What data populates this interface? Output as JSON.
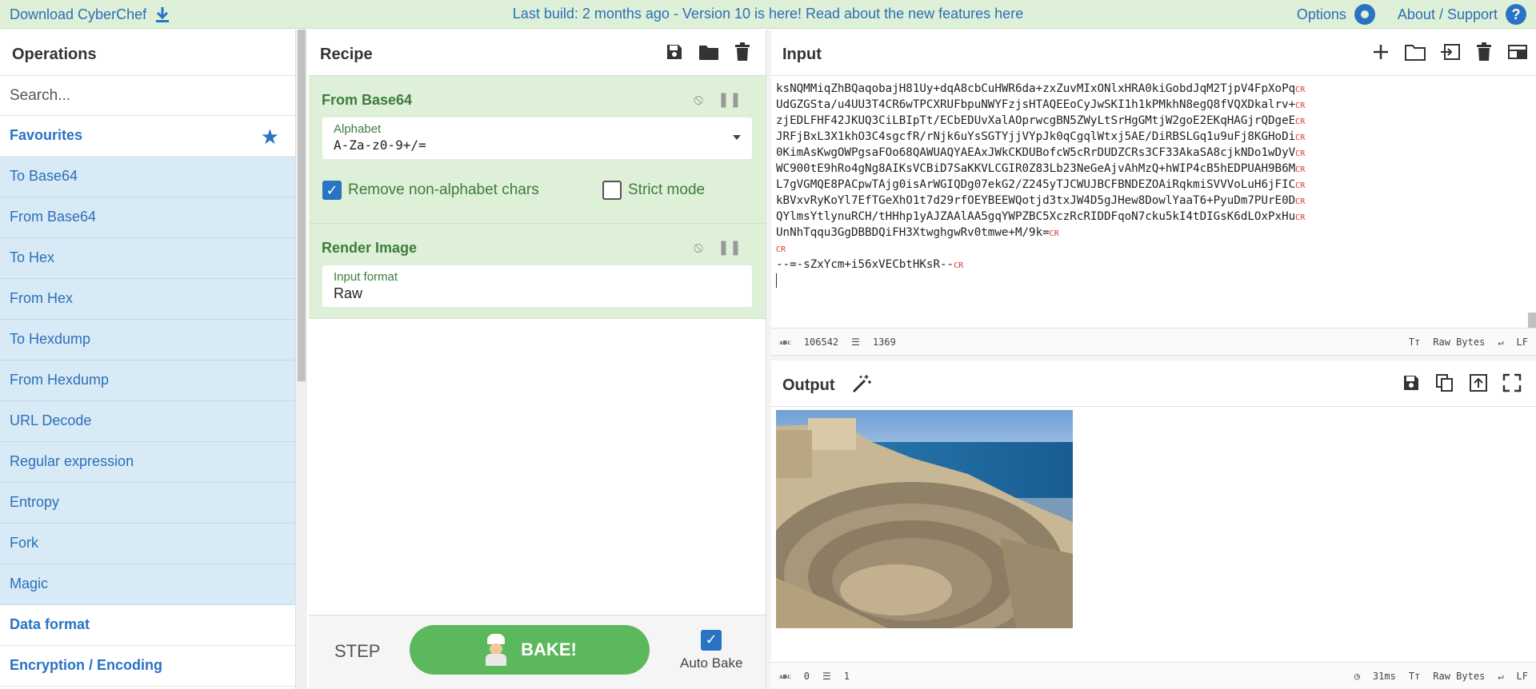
{
  "banner": {
    "download_label": "Download CyberChef",
    "notice": "Last build: 2 months ago - Version 10 is here! Read about the new features here",
    "options_label": "Options",
    "about_label": "About / Support",
    "help_glyph": "?"
  },
  "operations": {
    "title": "Operations",
    "search_placeholder": "Search...",
    "favourites_label": "Favourites",
    "items": [
      "To Base64",
      "From Base64",
      "To Hex",
      "From Hex",
      "To Hexdump",
      "From Hexdump",
      "URL Decode",
      "Regular expression",
      "Entropy",
      "Fork",
      "Magic"
    ],
    "categories_after": [
      "Data format",
      "Encryption / Encoding"
    ]
  },
  "recipe": {
    "title": "Recipe",
    "ops": [
      {
        "name": "From Base64",
        "alphabet_label": "Alphabet",
        "alphabet_value": "A-Za-z0-9+/=",
        "remove_label": "Remove non-alphabet chars",
        "remove_checked": true,
        "strict_label": "Strict mode",
        "strict_checked": false
      },
      {
        "name": "Render Image",
        "format_label": "Input format",
        "format_value": "Raw"
      }
    ],
    "step_label": "STEP",
    "bake_label": "BAKE!",
    "autobake_label": "Auto Bake",
    "autobake_checked": true
  },
  "input": {
    "title": "Input",
    "lines": [
      "ksNQMMiqZhBQaqobajH81Uy+dqA8cbCuHWR6da+zxZuvMIxONlxHRA0kiGobdJqM2TjpV4FpXoPq",
      "UdGZGSta/u4UU3T4CR6wTPCXRUFbpuNWYFzjsHTAQEEoCyJwSKI1h1kPMkhN8egQ8fVQXDkalrv+",
      "zjEDLFHF42JKUQ3CiLBIpTt/ECbEDUvXalAOprwcgBN5ZWyLtSrHgGMtjW2goE2EKqHAGjrQDgeE",
      "JRFjBxL3X1khO3C4sgcfR/rNjk6uYsSGTYjjVYpJk0qCgqlWtxj5AE/DiRBSLGq1u9uFj8KGHoDi",
      "0KimAsKwgOWPgsaFOo68QAWUAQYAEAxJWkCKDUBofcW5cRrDUDZCRs3CF33AkaSA8cjkNDo1wDyV",
      "WC900tE9hRo4gNg8AIKsVCBiD7SaKKVLCGIR0Z83Lb23NeGeAjvAhMzQ+hWIP4cB5hEDPUAH9B6M",
      "L7gVGMQE8PACpwTAjg0isArWGIQDg07ekG2/Z245yTJCWUJBCFBNDEZOAiRqkmiSVVVoLuH6jFIC",
      "kBVxvRyKoYl7EfTGeXhO1t7d29rfOEYBEEWQotjd3txJW4D5gJHew8DowlYaaT6+PyuDm7PUrE0D",
      "QYlmsYtlynuRCH/tHHhp1yAJZAAlAA5gqYWPZBC5XczRcRIDDFqoN7cku5kI4tDIGsK6dLOxPxHu",
      "UnNhTqqu3GgDBBDQiFH3XtwghgwRv0tmwe+M/9k=",
      "",
      "--=-sZxYcm+i56xVECbtHKsR--",
      ""
    ],
    "cr_marks": [
      true,
      true,
      true,
      true,
      true,
      true,
      true,
      true,
      true,
      true,
      true,
      true,
      false
    ],
    "cr_label": "CR",
    "chars": "106542",
    "lines_count": "1369",
    "encoding": "Raw Bytes",
    "eol": "LF"
  },
  "output": {
    "title": "Output",
    "chars": "0",
    "lines_count": "1",
    "time": "31ms",
    "encoding": "Raw Bytes",
    "eol": "LF"
  },
  "colors": {
    "banner_bg": "#dff0d8",
    "accent_blue": "#2a73c4",
    "op_green_bg": "#dff0d8",
    "bake_green": "#5cb85c",
    "fav_item_bg": "#d9eaf7"
  }
}
